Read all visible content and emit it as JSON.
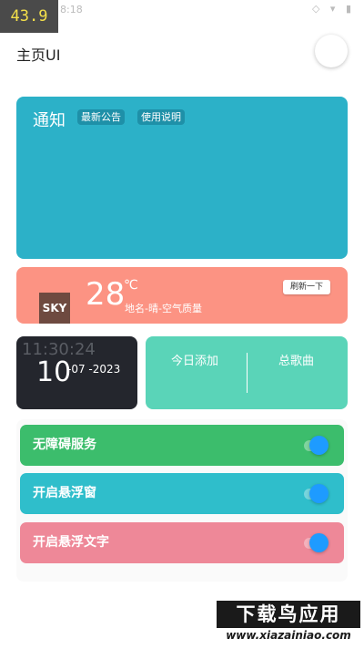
{
  "status": {
    "badge": "43.9",
    "time": "8:18",
    "icons": "◇ ▾ ▮"
  },
  "header": {
    "title": "主页UI"
  },
  "notice": {
    "title": "通知",
    "chips": [
      "最新公告",
      "使用说明"
    ]
  },
  "weather": {
    "icon_label": "SKY",
    "temperature": "28",
    "unit": "℃",
    "description": "地名-晴-空气质量",
    "refresh_label": "刷新一下"
  },
  "clock": {
    "time": "11:30:24",
    "day": "10",
    "month_year": "-07 -2023"
  },
  "stats": {
    "today_added": "今日添加",
    "total_songs": "总歌曲"
  },
  "toggles": [
    {
      "label": "无障碍服务",
      "color": "#3cbd6c",
      "on": true
    },
    {
      "label": "开启悬浮窗",
      "color": "#2fbecb",
      "on": true
    },
    {
      "label": "开启悬浮文字",
      "color": "#ee8898",
      "on": true
    }
  ],
  "watermark": {
    "top": "下载鸟应用",
    "bottom": "www.xiazainiao.com"
  }
}
